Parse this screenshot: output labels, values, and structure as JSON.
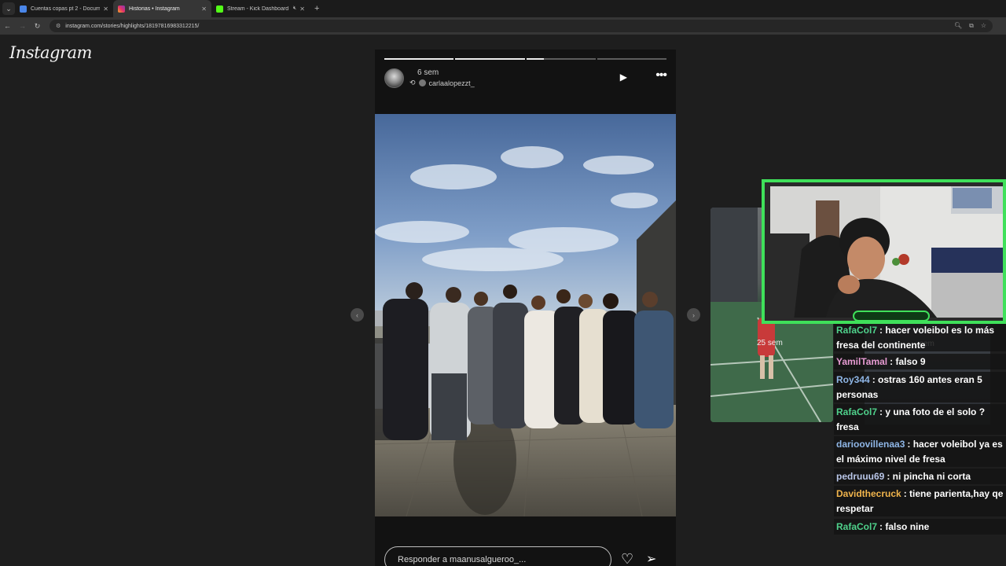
{
  "browser": {
    "tabs": [
      {
        "title": "Cuentas copas pt 2 - Documen",
        "favicon": "doc-icon",
        "color": "#4a86e8",
        "active": false
      },
      {
        "title": "Historias • Instagram",
        "favicon": "instagram-icon",
        "color": "#e1306c",
        "active": true
      },
      {
        "title": "Stream - Kick Dashboard",
        "favicon": "kick-icon",
        "color": "#53fc18",
        "active": false
      }
    ],
    "url": "instagram.com/stories/highlights/18197816983312215/"
  },
  "instagram": {
    "logo": "Instagram",
    "story": {
      "time": "6 sem",
      "reposted_user": "carlaalopezzt_",
      "reply_placeholder": "Responder a maanusalgueroo_...",
      "progress": [
        1.0,
        1.0,
        0.25,
        0.0
      ]
    },
    "next_story": {
      "time": "25 sem"
    },
    "behind_chat_time": "sem"
  },
  "chat": {
    "messages": [
      {
        "user": "RafaCol7",
        "color": "#4fd18b",
        "text": ": hacer voleibol es lo más fresa del continente"
      },
      {
        "user": "YamilTamal",
        "color": "#e79bd2",
        "text": ": falso 9"
      },
      {
        "user": "Roy344",
        "color": "#8fb6e6",
        "text": ": ostras 160 antes eran 5 personas"
      },
      {
        "user": "RafaCol7",
        "color": "#4fd18b",
        "text": ": y una foto de el solo ? fresa"
      },
      {
        "user": "darioovillenaa3",
        "color": "#8fb6e6",
        "text": ": hacer voleibol ya es el máximo nivel de fresa"
      },
      {
        "user": "pedruuu69",
        "color": "#b9c6e8",
        "text": ": ni pincha ni corta"
      },
      {
        "user": "Davidthecruck",
        "color": "#f0b44c",
        "text": ": tiene parienta,hay qe respetar"
      },
      {
        "user": "RafaCol7",
        "color": "#4fd18b",
        "text": ": falso nine"
      }
    ]
  }
}
